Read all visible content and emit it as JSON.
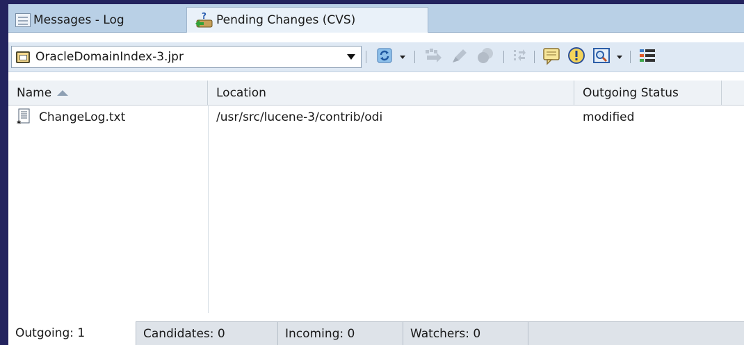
{
  "tabs": {
    "messages_log": "Messages - Log",
    "pending_changes": "Pending Changes (CVS)"
  },
  "toolbar": {
    "project_select": "OracleDomainIndex-3.jpr",
    "icons": [
      "refresh-icon",
      "add-files-icon",
      "commit-icon",
      "undo-changes-icon",
      "compare-icon",
      "comment-icon",
      "alert-icon",
      "filter-icon",
      "columns-icon"
    ]
  },
  "table": {
    "columns": [
      "Name",
      "Location",
      "Outgoing Status"
    ],
    "rows": [
      {
        "name": "ChangeLog.txt",
        "location": "/usr/src/lucene-3/contrib/odi",
        "status": "modified"
      }
    ]
  },
  "bottom_tabs": {
    "outgoing": "Outgoing: 1",
    "candidates": "Candidates: 0",
    "incoming": "Incoming: 0",
    "watchers": "Watchers: 0"
  },
  "colors": {
    "background": "#23235e",
    "tab_strip": "#b9d0e6",
    "toolbar": "#dfe9f4"
  }
}
